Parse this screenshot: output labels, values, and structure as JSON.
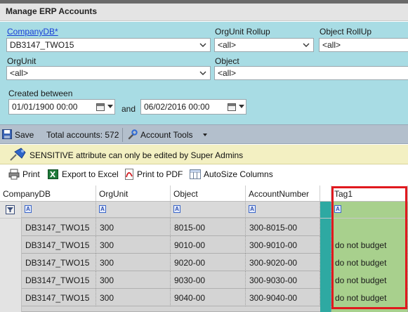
{
  "window": {
    "title": "Manage ERP Accounts"
  },
  "filters": {
    "company_db": {
      "label": "CompanyDB*",
      "value": "DB3147_TWO15"
    },
    "orgunit_rollup": {
      "label": "OrgUnit Rollup",
      "value": "<all>"
    },
    "object_rollup": {
      "label": "Object RollUp",
      "value": "<all>"
    },
    "orgunit": {
      "label": "OrgUnit",
      "value": "<all>"
    },
    "object": {
      "label": "Object",
      "value": "<all>"
    },
    "created_between": {
      "label": "Created between",
      "from": "01/01/1900  00:00",
      "and": "and",
      "to": "06/02/2016  00:00"
    }
  },
  "savebar": {
    "save_label": "Save",
    "total_accounts": "Total accounts: 572",
    "account_tools_label": "Account Tools"
  },
  "notice": {
    "text": "SENSITIVE attribute can only be edited by Super Admins"
  },
  "export_toolbar": {
    "print_label": "Print",
    "excel_label": "Export to Excel",
    "pdf_label": "Print to PDF",
    "autosize_label": "AutoSize Columns"
  },
  "grid": {
    "columns": [
      "CompanyDB",
      "OrgUnit",
      "Object",
      "AccountNumber",
      "Tag1"
    ],
    "filter_glyph": "A",
    "rows": [
      {
        "company": "DB3147_TWO15",
        "orgunit": "300",
        "object": "8015-00",
        "account": "300-8015-00",
        "tag1": ""
      },
      {
        "company": "DB3147_TWO15",
        "orgunit": "300",
        "object": "9010-00",
        "account": "300-9010-00",
        "tag1": "do not budget"
      },
      {
        "company": "DB3147_TWO15",
        "orgunit": "300",
        "object": "9020-00",
        "account": "300-9020-00",
        "tag1": "do not budget"
      },
      {
        "company": "DB3147_TWO15",
        "orgunit": "300",
        "object": "9030-00",
        "account": "300-9030-00",
        "tag1": "do not budget"
      },
      {
        "company": "DB3147_TWO15",
        "orgunit": "300",
        "object": "9040-00",
        "account": "300-9040-00",
        "tag1": "do not budget"
      }
    ]
  },
  "colors": {
    "filter_panel": "#a8dce4",
    "tag_column": "#a8d08d",
    "highlight_box": "#e0191e",
    "teal_column": "#2ea9a2"
  }
}
